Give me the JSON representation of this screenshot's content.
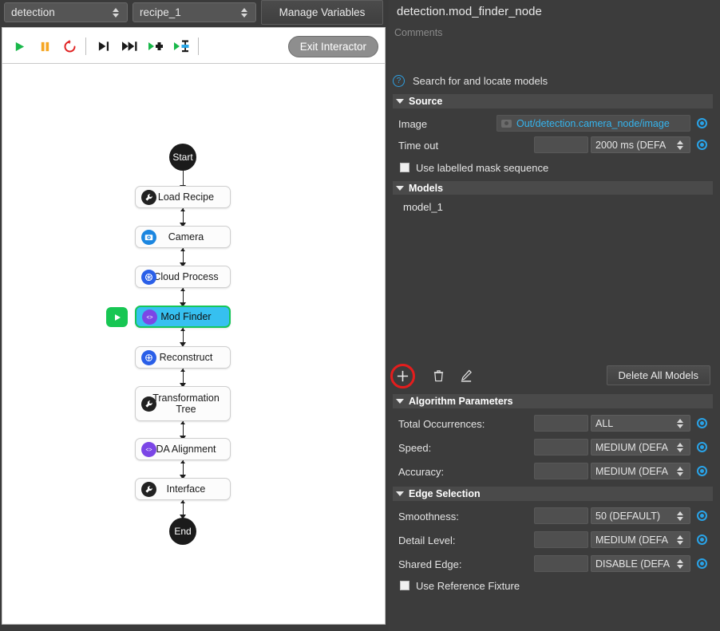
{
  "header": {
    "project_select": "detection",
    "recipe_select": "recipe_1",
    "manage_variables_label": "Manage Variables"
  },
  "toolbar": {
    "exit_interactor_label": "Exit Interactor",
    "icons": [
      {
        "name": "play-icon",
        "glyph": "▶"
      },
      {
        "name": "pause-icon",
        "glyph": "‖"
      },
      {
        "name": "reload-icon",
        "glyph": "↻"
      },
      {
        "name": "step-over-icon",
        "glyph": "▶|"
      },
      {
        "name": "step-forward-icon",
        "glyph": "▶▶|"
      },
      {
        "name": "run-to-node-icon",
        "glyph": "▶✚"
      },
      {
        "name": "run-to-breakpoint-icon",
        "glyph": "▶⬛"
      }
    ]
  },
  "flow": {
    "start_label": "Start",
    "end_label": "End",
    "nodes": [
      {
        "label": "Load Recipe",
        "icon": "wrench-icon",
        "icon_color": "#222222",
        "selected": false
      },
      {
        "label": "Camera",
        "icon": "camera-icon",
        "icon_color": "#1b86e0",
        "selected": false
      },
      {
        "label": "Cloud Process",
        "icon": "cloud-process-icon",
        "icon_color": "#2a5fe8",
        "selected": false
      },
      {
        "label": "Mod Finder",
        "icon": "code-icon",
        "icon_color": "#7b46e6",
        "selected": true
      },
      {
        "label": "Reconstruct",
        "icon": "reconstruct-icon",
        "icon_color": "#2a5fe8",
        "selected": false
      },
      {
        "label": "Transformation Tree",
        "icon": "wrench-icon",
        "icon_color": "#222222",
        "selected": false
      },
      {
        "label": "DA Alignment",
        "icon": "code-icon",
        "icon_color": "#7b46e6",
        "selected": false
      },
      {
        "label": "Interface",
        "icon": "wrench-icon",
        "icon_color": "#222222",
        "selected": false
      }
    ],
    "selected_marker": "run-here-icon",
    "selection_color": "#36c0f0",
    "selection_border_color": "#16c65a",
    "marker_color": "#17c653"
  },
  "inspector": {
    "title": "detection.mod_finder_node",
    "comments_placeholder": "Comments",
    "help_text": "Search for and locate models",
    "sections": {
      "source": {
        "title": "Source",
        "image_label": "Image",
        "image_value": "Out/detection.camera_node/image",
        "image_value_color": "#35b4ee",
        "timeout_label": "Time out",
        "timeout_text": "",
        "timeout_select": "2000 ms (DEFA",
        "mask_checkbox_label": "Use labelled mask sequence",
        "mask_checked": false
      },
      "models": {
        "title": "Models",
        "items": [
          "model_1"
        ],
        "add_label": "+",
        "delete_all_label": "Delete All Models",
        "add_icon": "plus-icon",
        "delete_icon": "trash-icon",
        "edit_icon": "pencil-icon",
        "highlight_color": "#e41d1d"
      },
      "algorithm_parameters": {
        "title": "Algorithm Parameters",
        "rows": [
          {
            "label": "Total Occurrences:",
            "text": "",
            "select": "ALL"
          },
          {
            "label": "Speed:",
            "text": "",
            "select": "MEDIUM (DEFA"
          },
          {
            "label": "Accuracy:",
            "text": "",
            "select": "MEDIUM (DEFA"
          }
        ]
      },
      "edge_selection": {
        "title": "Edge Selection",
        "rows": [
          {
            "label": "Smoothness:",
            "text": "",
            "select": "50 (DEFAULT)"
          },
          {
            "label": "Detail Level:",
            "text": "",
            "select": "MEDIUM (DEFA"
          },
          {
            "label": "Shared Edge:",
            "text": "",
            "select": "DISABLE (DEFA"
          }
        ],
        "fixture_checkbox_label": "Use Reference Fixture",
        "fixture_checked": false
      }
    }
  }
}
